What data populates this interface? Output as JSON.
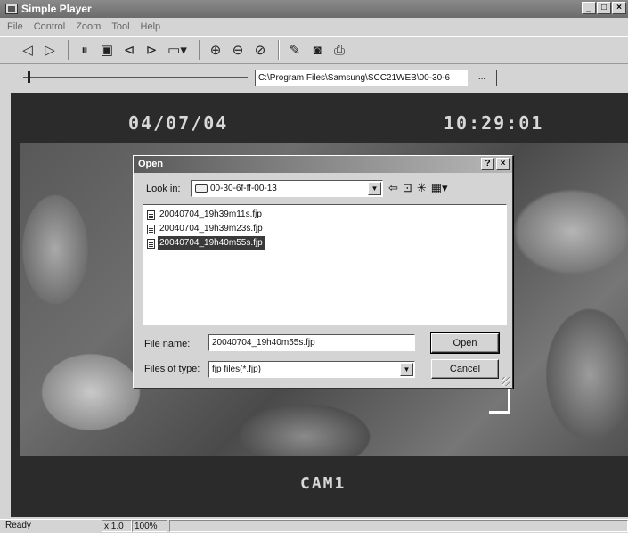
{
  "window": {
    "title": "Simple Player"
  },
  "title_controls": {
    "minimize": "_",
    "maximize": "□",
    "close": "×"
  },
  "menu": [
    "File",
    "Control",
    "Zoom",
    "Tool",
    "Help"
  ],
  "toolbar": {
    "icons": [
      "step-back-icon",
      "play-icon",
      "pause-icon",
      "stop-icon",
      "rewind-icon",
      "fast-forward-icon",
      "monitor-dropdown-icon",
      "zoom-in-icon",
      "zoom-out-icon",
      "zoom-fit-icon",
      "edit-icon",
      "snapshot-camera-icon",
      "print-icon"
    ]
  },
  "seek": {
    "position_fraction": 0.02
  },
  "path": {
    "value": "C:\\Program Files\\Samsung\\SCC21WEB\\00-30-6",
    "browse_label": "..."
  },
  "video": {
    "date": "04/07/04",
    "time": "10:29:01",
    "camera": "CAM1"
  },
  "dialog": {
    "title": "Open",
    "help": "?",
    "close": "×",
    "look_in_label": "Look in:",
    "look_in_value": "00-30-6f-ff-00-13",
    "files": [
      {
        "name": "20040704_19h39m11s.fjp",
        "selected": false
      },
      {
        "name": "20040704_19h39m23s.fjp",
        "selected": false
      },
      {
        "name": "20040704_19h40m55s.fjp",
        "selected": true
      }
    ],
    "file_name_label": "File name:",
    "file_name_value": "20040704_19h40m55s.fjp",
    "file_type_label": "Files of type:",
    "file_type_value": "fjp files(*.fjp)",
    "open_label": "Open",
    "cancel_label": "Cancel"
  },
  "status": {
    "text": "Ready",
    "speed": "x 1.0",
    "zoom": "100%"
  }
}
